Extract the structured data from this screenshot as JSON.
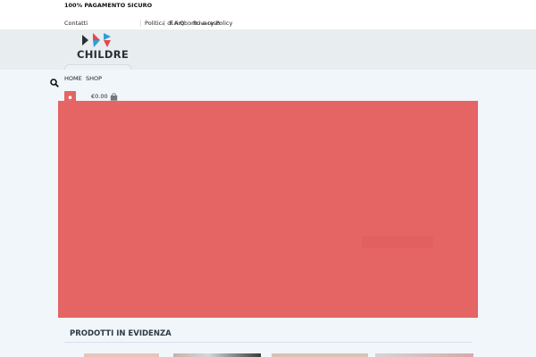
{
  "topbar": {
    "message": "100% PAGAMENTO SICURO"
  },
  "links": [
    {
      "label": "Contatti"
    },
    {
      "label": "Politica di rimborso e reso"
    },
    {
      "label": "F.A.Q"
    },
    {
      "label": "Privacy Policy"
    }
  ],
  "logo": {
    "text": "CHILDRE",
    "colors": {
      "red": "#e5484d",
      "blue": "#2e9fd8",
      "dark": "#2a2f36"
    }
  },
  "nav": {
    "home": "HOME",
    "shop": "SHOP"
  },
  "icons": {
    "search": "search-icon",
    "user": "user-icon",
    "cart": "cart-icon"
  },
  "cart": {
    "price": "€0.00"
  },
  "hero": {
    "color": "#e56464"
  },
  "featured": {
    "title": "PRODOTTI IN EVIDENZA"
  },
  "colors": {
    "accent": "#e56464",
    "header_bg": "#e8edf0",
    "page_bg": "#f1f6fb"
  }
}
